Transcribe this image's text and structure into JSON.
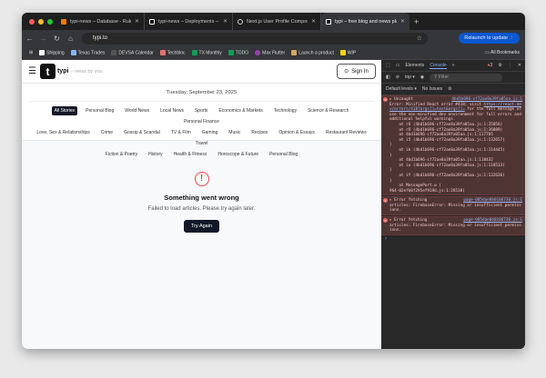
{
  "browser": {
    "tabs": [
      {
        "title": "typi-news – Database - Rules",
        "color": "#f57c00"
      },
      {
        "title": "typi-news – Deployments – V",
        "color": "#ffffff"
      },
      {
        "title": "Next.js User Profile Compone",
        "color": "#cccccc"
      },
      {
        "title": "typi – free blog and news pla",
        "color": "#000000"
      }
    ],
    "url": "typi.to",
    "relaunch": "Relaunch to update",
    "bookmarks": [
      "Shipping",
      "Texas Trades",
      "DEVSA Calendar",
      "Techbloc",
      "TX Monthly",
      "TODO",
      "Max Flutter",
      "Launch a product",
      "WIP"
    ],
    "all_bookmarks": "All Bookmarks"
  },
  "site": {
    "logo": "t",
    "brand": "typi",
    "tagline": "– news by you",
    "sign_in": "Sign In",
    "date": "Tuesday, September 23, 2025",
    "categories": [
      "All Stories",
      "Personal Blog",
      "World News",
      "Local News",
      "Sports",
      "Economics & Markets",
      "Technology",
      "Science & Research",
      "Personal Finance",
      "Love, Sex & Relationships",
      "Crime",
      "Gossip & Scandal",
      "TV & Film",
      "Gaming",
      "Music",
      "Recipes",
      "Opinion & Essays",
      "Restaurant Reviews",
      "Travel",
      "Fiction & Poetry",
      "History",
      "Health & Fitness",
      "Horoscope & Future",
      "Personal Blog"
    ],
    "error": {
      "icon": "!",
      "title": "Something went wrong",
      "message": "Failed to load articles. Please try again later.",
      "button": "Try Again"
    }
  },
  "devtools": {
    "tabs": [
      "Elements",
      "Console"
    ],
    "error_count": "3",
    "context": "top ▾",
    "filter_placeholder": "Filter",
    "levels": "Default levels ▾",
    "issues": "No Issues",
    "messages": [
      {
        "head": "▸ Uncaught",
        "src": "4bd1b696-cf72ae8a39fa05aa.js:1",
        "body": "Error: Minified React error #418; visit",
        "link": "https://react.dev/errors/418?args[]=text&args[]=",
        "rest": " for the full message or use the non-minified dev environment for full errors and additional helpful warnings.",
        "stack": [
          "    at rO (4bd1b696-cf72ae8a39fa05aa.js:1:35856)",
          "    at rO (4bd1b696-cf72ae8a39fa05aa.js:1:36089)",
          "    at 4bd1b696-cf72ae8a39fa05aa.js:1:117785",
          "    at i5 (4bd1b696-cf72ae8a39fa05aa.js:1:132657)",
          "}",
          "    at ib (4bd1b696-cf72ae8a39fa05aa.js:1:114445)",
          "}",
          "    at 4bd1b696-cf72ae8a39fa05aa.js:1:118432",
          "    at io (4bd1b696-cf72ae8a39fa05aa.js:1:118533)",
          "}",
          "    at iY (4bd1b696-cf72ae8a39fa05aa.js:1:132636)",
          "}",
          "    at MessagePort.w (",
          "964-02efb0f295ef919d.js:1:26538)"
        ]
      },
      {
        "head": "▸ Error fetching",
        "src": "page-085dae0b0106730.js:1",
        "body": "articles: FirebaseError: Missing or insufficient permissions."
      },
      {
        "head": "▸ Error fetching",
        "src": "page-085dae0b0106730.js:1",
        "body": "articles: FirebaseError: Missing or insufficient permissions."
      }
    ],
    "prompt": "›"
  }
}
